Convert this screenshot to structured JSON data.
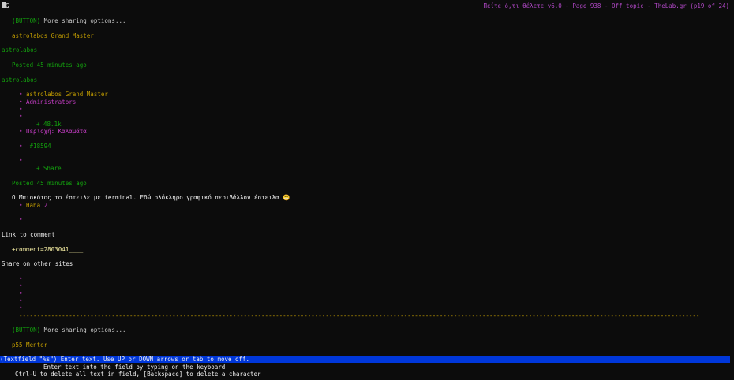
{
  "header": {
    "cursor_label": "G",
    "title": "Πείτε ό,τι θέλετε v6.0 - Page 938 - Off topic - TheLab.gr (p19 of 24)"
  },
  "post": {
    "more_sharing_1": {
      "tag": "(BUTTON)",
      "label": " More sharing options..."
    },
    "author_rank": "astrolabos Grand Master",
    "author_link": "astrolabos",
    "posted_1": "Posted 45 minutes ago",
    "author_link_2": "astrolabos",
    "profile": {
      "rank": "astrolabos Grand Master",
      "group": "Administrators",
      "reputation": "+ 48.1k",
      "region": "Περιοχή: Καλαμάτα",
      "post_id": "#18594",
      "share": "+ Share"
    },
    "posted_2": "Posted 45 minutes ago",
    "content": "Ο Μπισκότος το έστειλε με terminal. Εδώ ολόκληρο γραφικό περιβάλλον έστειλα 😁",
    "reaction": {
      "label": "Haha",
      "count": "2"
    },
    "link_to_comment": "Link to comment",
    "comment_field": "+comment=2803041____",
    "share_on_other_sites": "Share on other sites",
    "more_sharing_2": {
      "tag": "(BUTTON)",
      "label": " More sharing options..."
    },
    "next_author_rank": "p55 Mentor"
  },
  "divider": "-------------------------------------------------------------------------------------------------------------------------------------------------------------------------------------------------------------------------------------------------------------",
  "statusbar": {
    "line1": "(Textfield \"%s\") Enter text. Use UP or DOWN arrows or tab to move off.",
    "line2": "Enter text into the field by typing on the keyboard",
    "line3": "Ctrl-U to delete all text in field, [Backspace] to delete a character"
  },
  "bullet_glyph": "•",
  "colors": {
    "background": "#0c0c0c",
    "status_bar": "#0037da",
    "green": "#13a10e",
    "yellow": "#c19c00",
    "magenta": "#c43dc4"
  }
}
